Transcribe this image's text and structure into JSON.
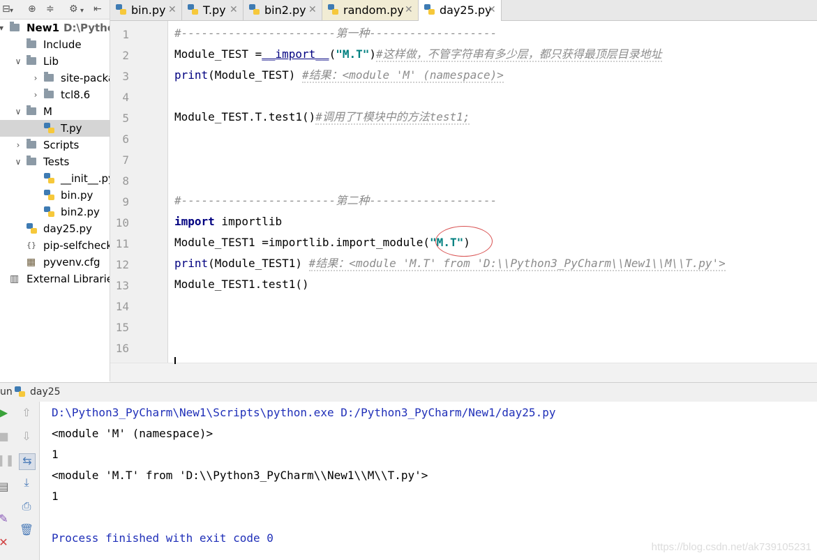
{
  "project": {
    "tree": [
      {
        "label": "New1",
        "sub": "D:\\Python",
        "arrow": "▾",
        "icon": "folder",
        "level": 0,
        "bold": true
      },
      {
        "label": "Include",
        "arrow": "",
        "icon": "folder",
        "level": 1
      },
      {
        "label": "Lib",
        "arrow": "∨",
        "icon": "folder",
        "level": 1
      },
      {
        "label": "site-packa",
        "arrow": "›",
        "icon": "folder",
        "level": 2
      },
      {
        "label": "tcl8.6",
        "arrow": "›",
        "icon": "folder",
        "level": 2
      },
      {
        "label": "M",
        "arrow": "∨",
        "icon": "folder",
        "level": 1
      },
      {
        "label": "T.py",
        "arrow": "",
        "icon": "python",
        "level": 2,
        "selected": true
      },
      {
        "label": "Scripts",
        "arrow": "›",
        "icon": "folder",
        "level": 1
      },
      {
        "label": "Tests",
        "arrow": "∨",
        "icon": "folder",
        "level": 1
      },
      {
        "label": "__init__.py",
        "arrow": "",
        "icon": "python",
        "level": 2
      },
      {
        "label": "bin.py",
        "arrow": "",
        "icon": "python",
        "level": 2
      },
      {
        "label": "bin2.py",
        "arrow": "",
        "icon": "python",
        "level": 2
      },
      {
        "label": "day25.py",
        "arrow": "",
        "icon": "python",
        "level": 1
      },
      {
        "label": "pip-selfcheck",
        "arrow": "",
        "icon": "json",
        "level": 1
      },
      {
        "label": "pyvenv.cfg",
        "arrow": "",
        "icon": "cfg",
        "level": 1
      },
      {
        "label": "External Libraries",
        "arrow": "",
        "icon": "library",
        "level": 0
      }
    ]
  },
  "tabs": [
    {
      "label": "bin.py",
      "active": false
    },
    {
      "label": "T.py",
      "active": false
    },
    {
      "label": "bin2.py",
      "active": false
    },
    {
      "label": "random.py",
      "active": false
    },
    {
      "label": "day25.py",
      "active": true
    }
  ],
  "editor": {
    "line_numbers": [
      "1",
      "2",
      "3",
      "4",
      "5",
      "6",
      "7",
      "8",
      "9",
      "10",
      "11",
      "12",
      "13",
      "14",
      "15",
      "16"
    ],
    "lines": {
      "l1": "#-----------------------第一种-------------------",
      "l2_a": "Module_TEST =",
      "l2_b": "__import__",
      "l2_c": "(",
      "l2_d": "\"M.T\"",
      "l2_e": ")",
      "l2_f": "#这样做，不管字符串有多少层，都只获得最顶层目录地址",
      "l3_a": "print",
      "l3_b": "(Module_TEST) ",
      "l3_c": "#结果：<module 'M' (namespace)>",
      "l5_a": "Module_TEST.T.test1()",
      "l5_b": "#调用了T模块中的方法test1;",
      "l9": "#-----------------------第二种-------------------",
      "l10_a": "import",
      "l10_b": " importlib",
      "l11_a": "Module_TEST1 =importlib.import_module(",
      "l11_b": "\"M.T\"",
      "l11_c": ")",
      "l12_a": "print",
      "l12_b": "(Module_TEST1) ",
      "l12_c": "#结果：<module 'M.T' from 'D:\\\\Python3_PyCharm\\\\New1\\\\M\\\\T.py'>",
      "l13": "Module_TEST1.test1()"
    }
  },
  "run": {
    "label": "un",
    "config": "day25",
    "output": [
      {
        "text": "D:\\Python3_PyCharm\\New1\\Scripts\\python.exe D:/Python3_PyCharm/New1/day25.py",
        "color": "blue"
      },
      {
        "text": "<module 'M' (namespace)>",
        "color": "black"
      },
      {
        "text": "1",
        "color": "black"
      },
      {
        "text": "<module 'M.T' from 'D:\\\\Python3_PyCharm\\\\New1\\\\M\\\\T.py'>",
        "color": "black"
      },
      {
        "text": "1",
        "color": "black"
      },
      {
        "text": "",
        "color": "black"
      },
      {
        "text": "Process finished with exit code 0",
        "color": "blue"
      }
    ]
  },
  "watermark": "https://blog.csdn.net/ak739105231",
  "colors": {
    "keyword": "#000080",
    "string": "#008080",
    "comment": "#8c8c8c",
    "console_blue": "#1f2fb8",
    "annotation_circle": "#d85050"
  }
}
